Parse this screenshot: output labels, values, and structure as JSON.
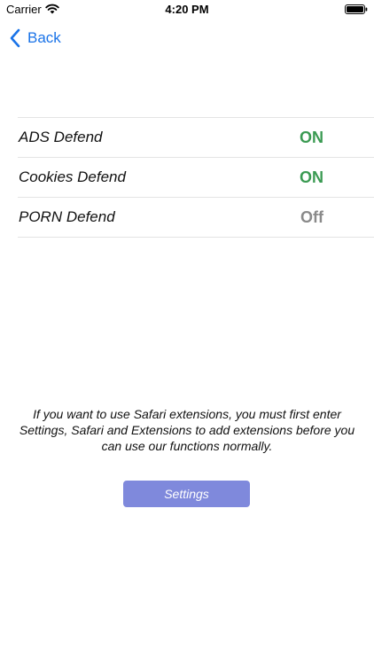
{
  "status_bar": {
    "carrier": "Carrier",
    "time": "4:20 PM"
  },
  "nav": {
    "back_label": "Back"
  },
  "toggles": [
    {
      "label": "ADS Defend",
      "state": "ON"
    },
    {
      "label": "Cookies Defend",
      "state": "ON"
    },
    {
      "label": "PORN Defend",
      "state": "Off"
    }
  ],
  "instructions": "If you want to use Safari extensions, you must first enter Settings, Safari and Extensions to add extensions before you can use our functions normally.",
  "settings_button": {
    "label": "Settings"
  },
  "colors": {
    "accent": "#1a73e8",
    "on": "#3a9a52",
    "off": "#8a8a8a",
    "button": "#7f89dc"
  }
}
